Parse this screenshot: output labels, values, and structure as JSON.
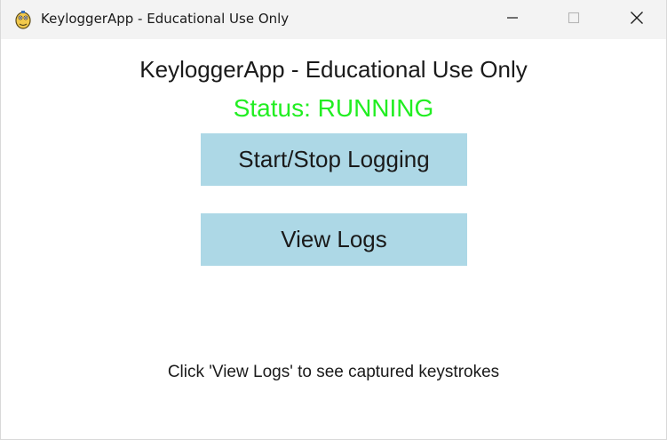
{
  "window": {
    "title": "KeyloggerApp - Educational Use Only",
    "icon": "pygame-snake-icon",
    "controls": {
      "minimize_icon": "minimize-icon",
      "maximize_icon": "maximize-icon",
      "close_icon": "close-icon"
    }
  },
  "main": {
    "heading": "KeyloggerApp - Educational Use Only",
    "status_text": "Status: RUNNING",
    "buttons": {
      "start_stop_label": "Start/Stop Logging",
      "view_logs_label": "View Logs"
    },
    "hint": "Click 'View Logs' to see captured keystrokes"
  },
  "colors": {
    "titlebar": "#f3f3f3",
    "status_running": "#22ee22",
    "button_bg": "#add8e6",
    "text": "#1a1a1a"
  }
}
